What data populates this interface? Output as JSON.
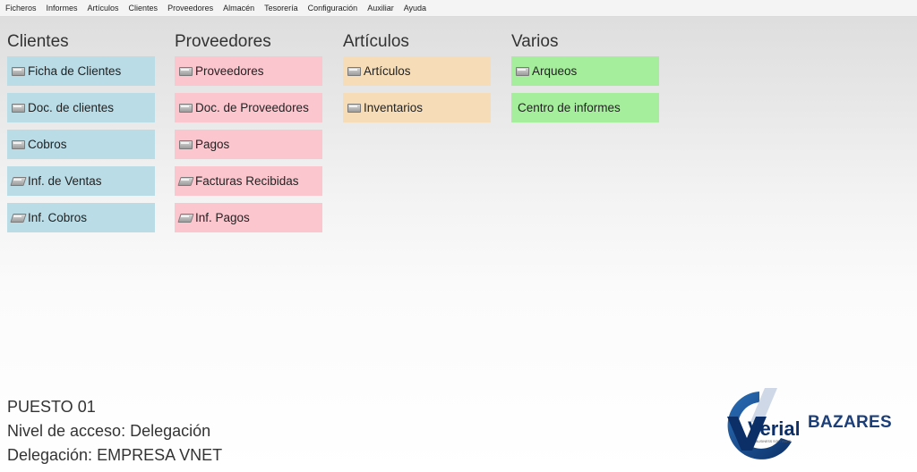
{
  "menu": [
    "Ficheros",
    "Informes",
    "Artículos",
    "Clientes",
    "Proveedores",
    "Almacén",
    "Tesorería",
    "Configuración",
    "Auxiliar",
    "Ayuda"
  ],
  "columns": {
    "clientes": {
      "title": "Clientes",
      "items": [
        "Ficha de Clientes",
        "Doc. de clientes",
        "Cobros",
        "Inf. de Ventas",
        "Inf. Cobros"
      ]
    },
    "proveedores": {
      "title": "Proveedores",
      "items": [
        "Proveedores",
        "Doc. de Proveedores",
        "Pagos",
        "Facturas Recibidas",
        "Inf. Pagos"
      ]
    },
    "articulos": {
      "title": "Artículos",
      "items": [
        "Artículos",
        "Inventarios"
      ]
    },
    "varios": {
      "title": "Varios",
      "items": [
        "Arqueos",
        "Centro de informes"
      ]
    }
  },
  "colors": {
    "clientes": "#b9dce6",
    "proveedores": "#fcc6cf",
    "articulos": "#f6ddb8",
    "varios": "#a5ef9c",
    "brand": "#1c3f7a"
  },
  "icons": {
    "module": "folder-module-icon",
    "report": "report-module-icon"
  },
  "info": {
    "puesto": "PUESTO 01",
    "nivel": "Nivel de acceso: Delegación",
    "delegacion": "Delegación: EMPRESA VNET"
  },
  "logo": {
    "text": "Verial",
    "tagline": "BUSINESS SOFTWARE"
  },
  "brand_label": "BAZARES"
}
